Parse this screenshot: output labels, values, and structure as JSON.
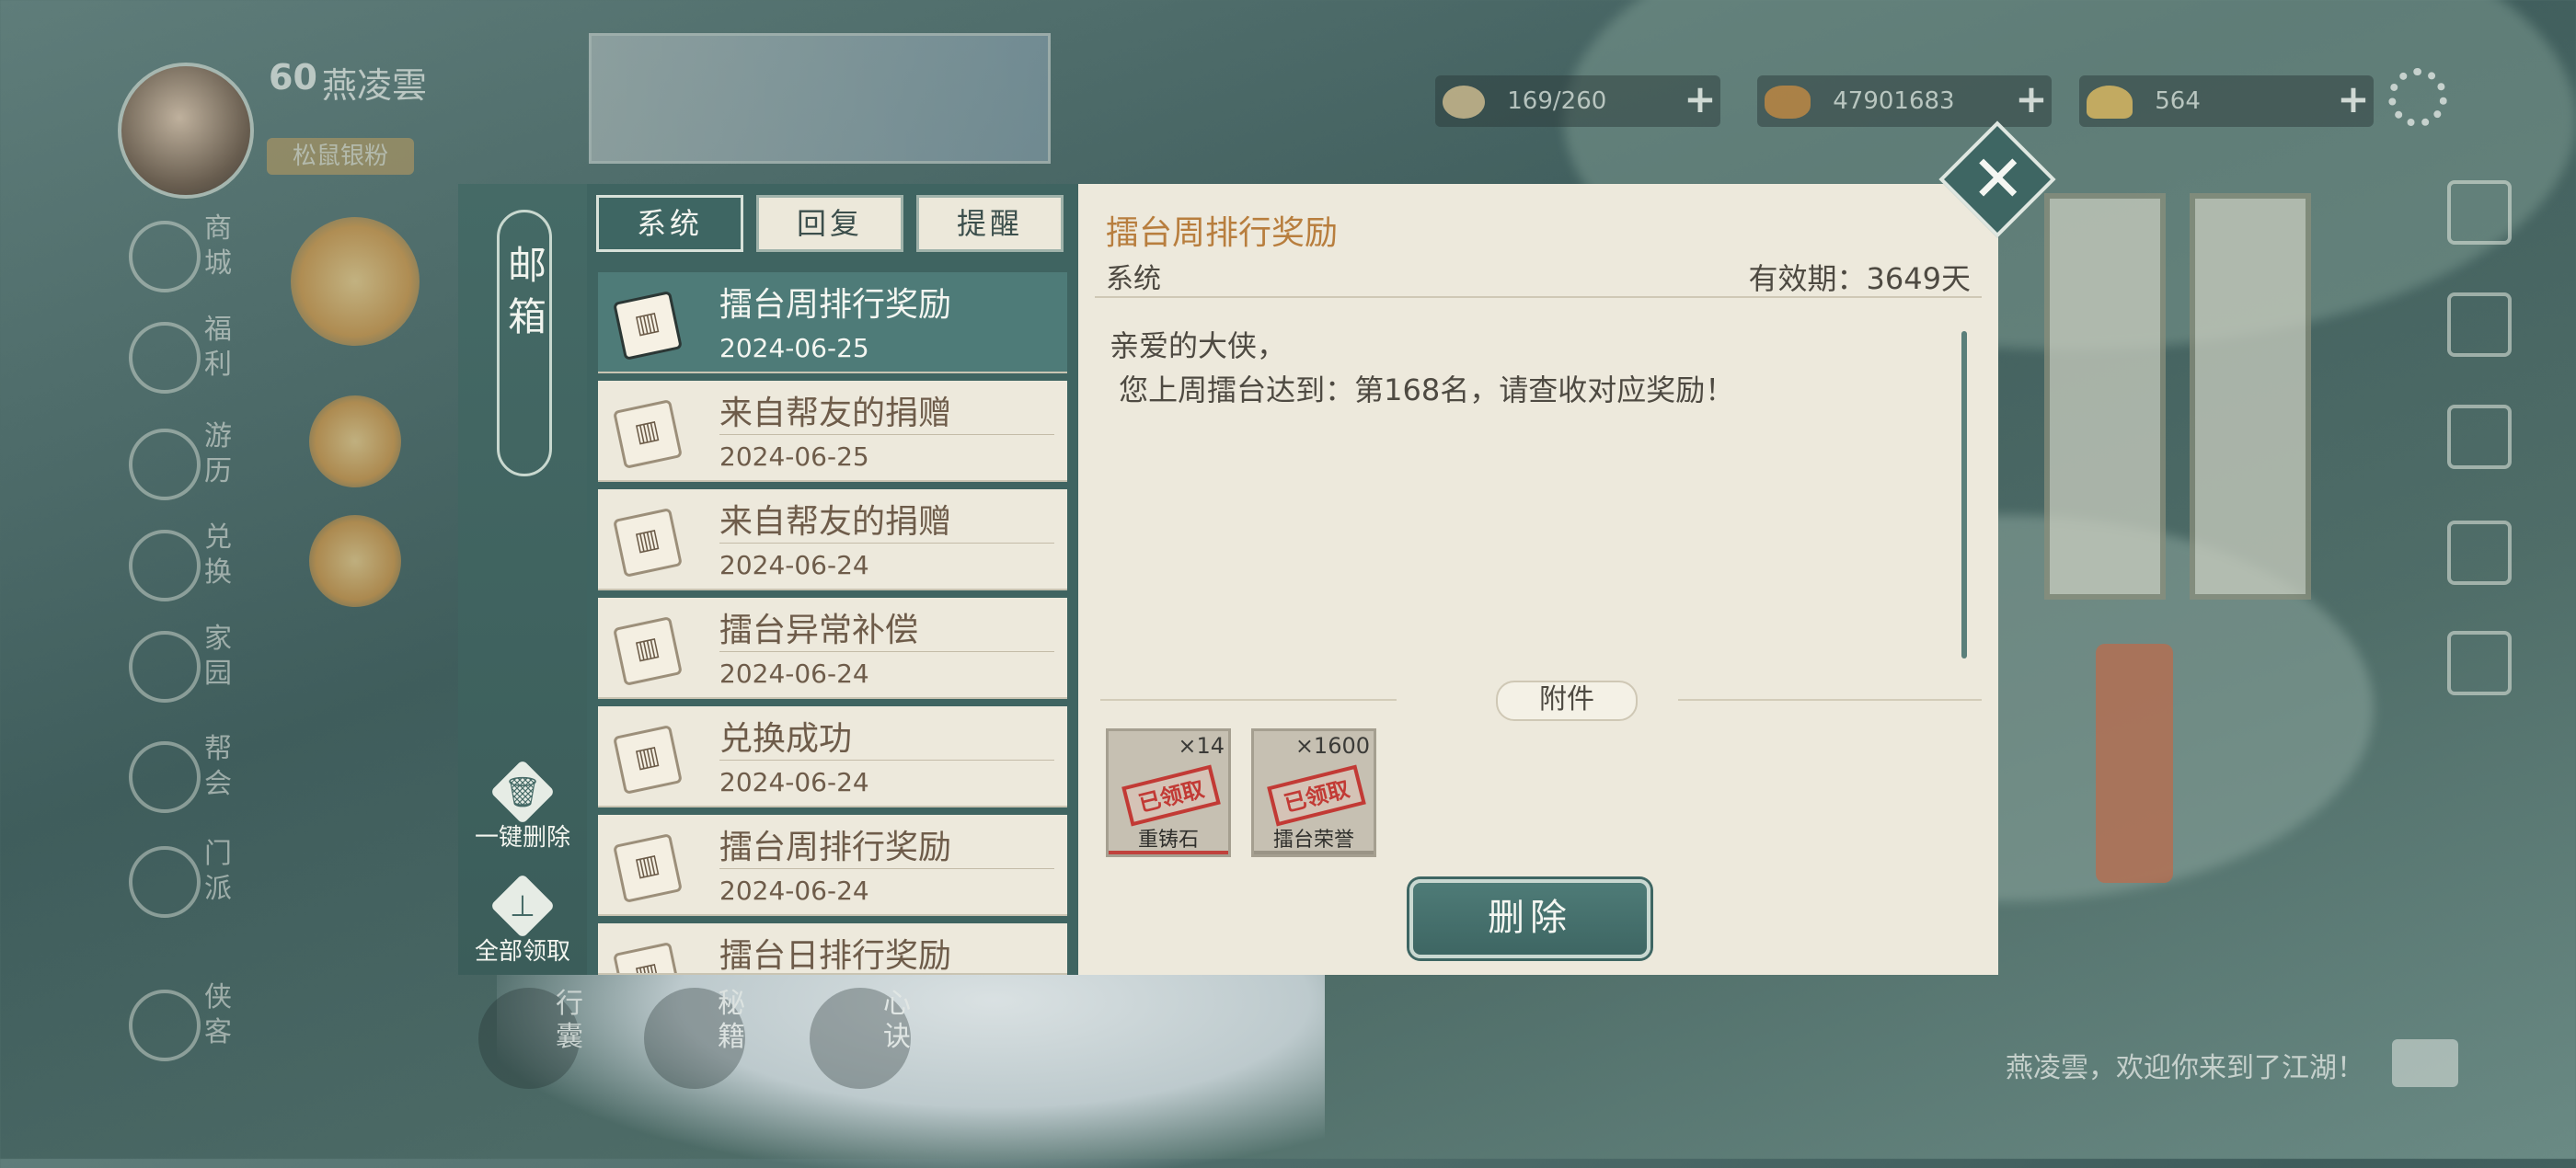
{
  "player": {
    "level": "60",
    "name": "燕凌雲",
    "title": "松鼠银粉"
  },
  "resources": [
    {
      "value": "169/260",
      "icon": "stamina-icon"
    },
    {
      "value": "47901683",
      "icon": "coin-icon"
    },
    {
      "value": "564",
      "icon": "ingot-icon"
    }
  ],
  "left_nav": [
    {
      "label": "商城",
      "icon": "shop-icon"
    },
    {
      "label": "福利",
      "icon": "gift-icon"
    },
    {
      "label": "游历",
      "icon": "horse-icon"
    },
    {
      "label": "兑换",
      "icon": "exchange-icon"
    },
    {
      "label": "家园",
      "icon": "home-icon"
    },
    {
      "label": "帮会",
      "icon": "guild-icon"
    },
    {
      "label": "门派",
      "icon": "sect-icon"
    },
    {
      "label": "侠客",
      "icon": "hero-icon"
    }
  ],
  "mailbox": {
    "title": "邮箱",
    "delete_all_label": "一键删除",
    "claim_all_label": "全部领取",
    "tabs": [
      "系统",
      "回复",
      "提醒"
    ],
    "active_tab": 0,
    "items": [
      {
        "title": "擂台周排行奖励",
        "date": "2024-06-25"
      },
      {
        "title": "来自帮友的捐赠",
        "date": "2024-06-25"
      },
      {
        "title": "来自帮友的捐赠",
        "date": "2024-06-24"
      },
      {
        "title": "擂台异常补偿",
        "date": "2024-06-24"
      },
      {
        "title": "兑换成功",
        "date": "2024-06-24"
      },
      {
        "title": "擂台周排行奖励",
        "date": "2024-06-24"
      },
      {
        "title": "擂台日排行奖励",
        "date": ""
      }
    ],
    "selected_index": 0
  },
  "detail": {
    "title": "擂台周排行奖励",
    "sender": "系统",
    "validity": "有效期：3649天",
    "body_line1": "亲爱的大侠，",
    "body_line2": " 您上周擂台达到：第168名，请查收对应奖励！",
    "attachments_label": "附件",
    "attachments": [
      {
        "name": "重铸石",
        "count": "×14",
        "status": "已领取",
        "rarity_color": "#c0413c"
      },
      {
        "name": "擂台荣誉",
        "count": "×1600",
        "status": "已领取",
        "rarity_color": "#9a9486"
      }
    ],
    "delete_label": "删除"
  },
  "bottom_shortcuts": [
    "行囊",
    "秘籍",
    "心诀"
  ],
  "chat_message": "燕凌雲，欢迎你来到了江湖！",
  "colors": {
    "accent": "#3e6663",
    "title_orange": "#b87e3e",
    "paper": "#ede9dc"
  }
}
